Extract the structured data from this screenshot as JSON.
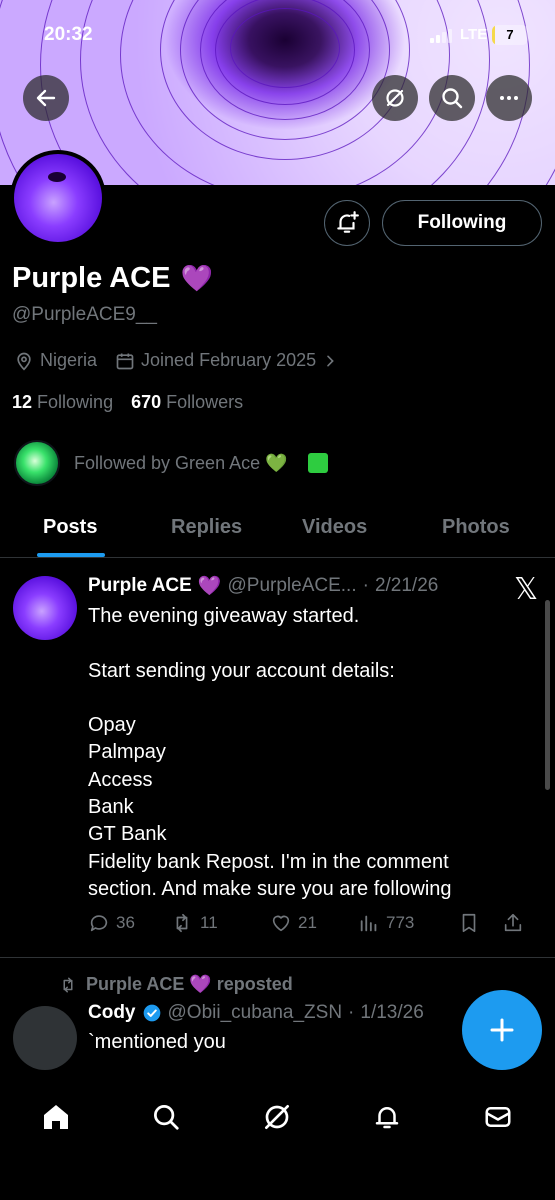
{
  "status_bar": {
    "time": "20:32",
    "network": "LTE",
    "battery": "7",
    "battery_level": 0.07
  },
  "header": {
    "back_icon": "arrow-left-icon",
    "grok_icon": "grok-icon",
    "search_icon": "search-icon",
    "more_icon": "more-icon"
  },
  "profile": {
    "name": "Purple ACE",
    "name_emoji": "💜",
    "handle": "@PurpleACE9__",
    "location": "Nigeria",
    "joined": "Joined February 2025",
    "following_count": "12",
    "following_label": "Following",
    "followers_count": "670",
    "followers_label": "Followers",
    "follow_button": "Following",
    "followed_by": "Followed by Green Ace 💚"
  },
  "tabs": [
    "Posts",
    "Replies",
    "Videos",
    "Photos"
  ],
  "posts": [
    {
      "author": "Purple ACE",
      "emoji": "💜",
      "handle": "@PurpleACE...",
      "date": "2/21/26",
      "body": "The evening giveaway started.\n\nStart sending your account details:\n\nOpay\nPalmpay\nAccess\nBank\nGT Bank\nFidelity bank Repost. I'm in the comment\nsection. And make sure you are following",
      "replies": "36",
      "reposts": "11",
      "likes": "21",
      "views": "773"
    },
    {
      "repost_label": "Purple ACE 💜 reposted",
      "author": "Cody",
      "handle": "@Obii_cubana_ZSN",
      "date": "1/13/26",
      "body": "`mentioned you"
    }
  ],
  "colors": {
    "accent": "#1d9bf0",
    "muted": "#71767b",
    "divider": "#2f3336",
    "purple": "#8a3dff"
  }
}
